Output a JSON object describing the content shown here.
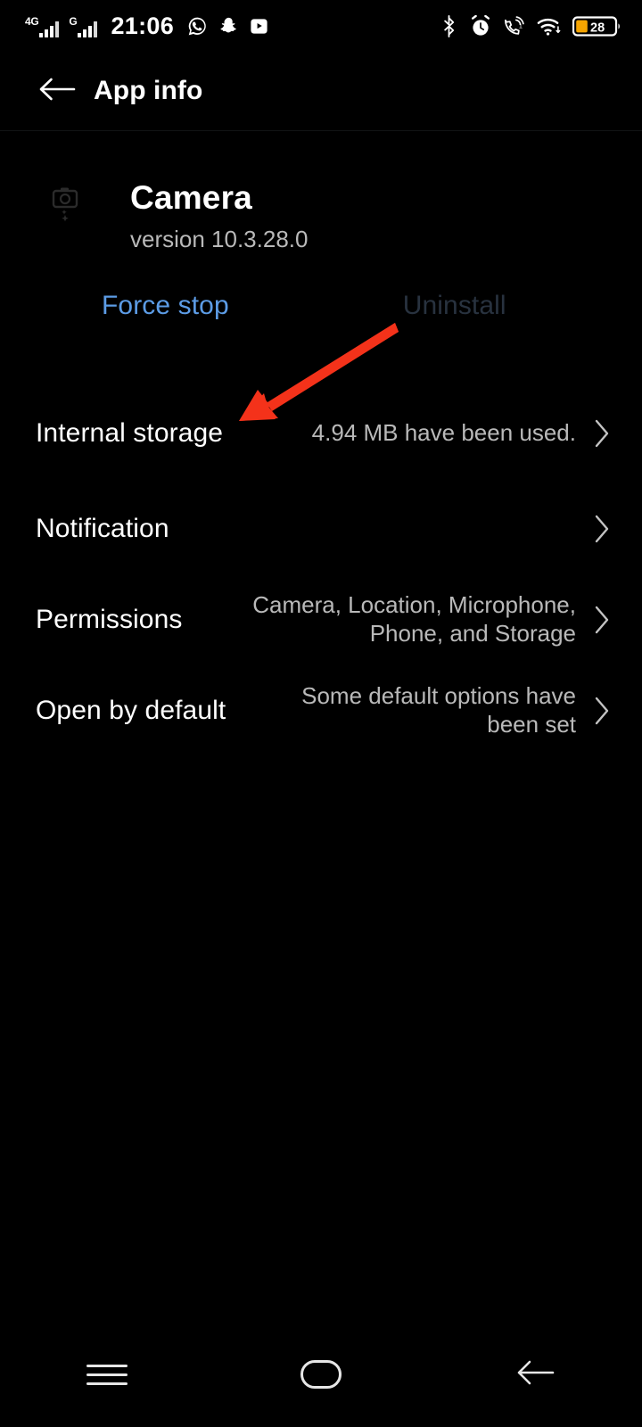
{
  "status_bar": {
    "network_primary": "4G",
    "network_secondary": "G",
    "time": "21:06",
    "left_icons": [
      "whatsapp-icon",
      "snapchat-icon",
      "youtube-icon"
    ],
    "right_icons": [
      "bluetooth-icon",
      "alarm-icon",
      "wifi-calling-icon",
      "wifi-icon"
    ],
    "battery_percent": "28",
    "battery_color": "#f5a400"
  },
  "header": {
    "title": "App info",
    "back_icon": "arrow-left-icon"
  },
  "app": {
    "icon": "camera-icon",
    "name": "Camera",
    "version": "version 10.3.28.0",
    "force_stop_label": "Force stop",
    "force_stop_color": "#5c9ce6",
    "uninstall_label": "Uninstall",
    "uninstall_color": "#28323f",
    "uninstall_disabled": "true"
  },
  "rows": [
    {
      "title": "Internal storage",
      "value": "4.94 MB have been used.",
      "chevron": "chevron-right-icon"
    },
    {
      "title": "Notification",
      "value": "",
      "chevron": "chevron-right-icon"
    },
    {
      "title": "Permissions",
      "value": "Camera, Location, Microphone, Phone, and Storage",
      "chevron": "chevron-right-icon"
    },
    {
      "title": "Open by default",
      "value": "Some default options have been set",
      "chevron": "chevron-right-icon"
    }
  ],
  "annotation": {
    "type": "arrow",
    "color": "#f4321a",
    "points_to": "Internal storage"
  },
  "navbar": {
    "recents": "menu-icon",
    "home": "home-icon",
    "back": "arrow-left-icon"
  }
}
